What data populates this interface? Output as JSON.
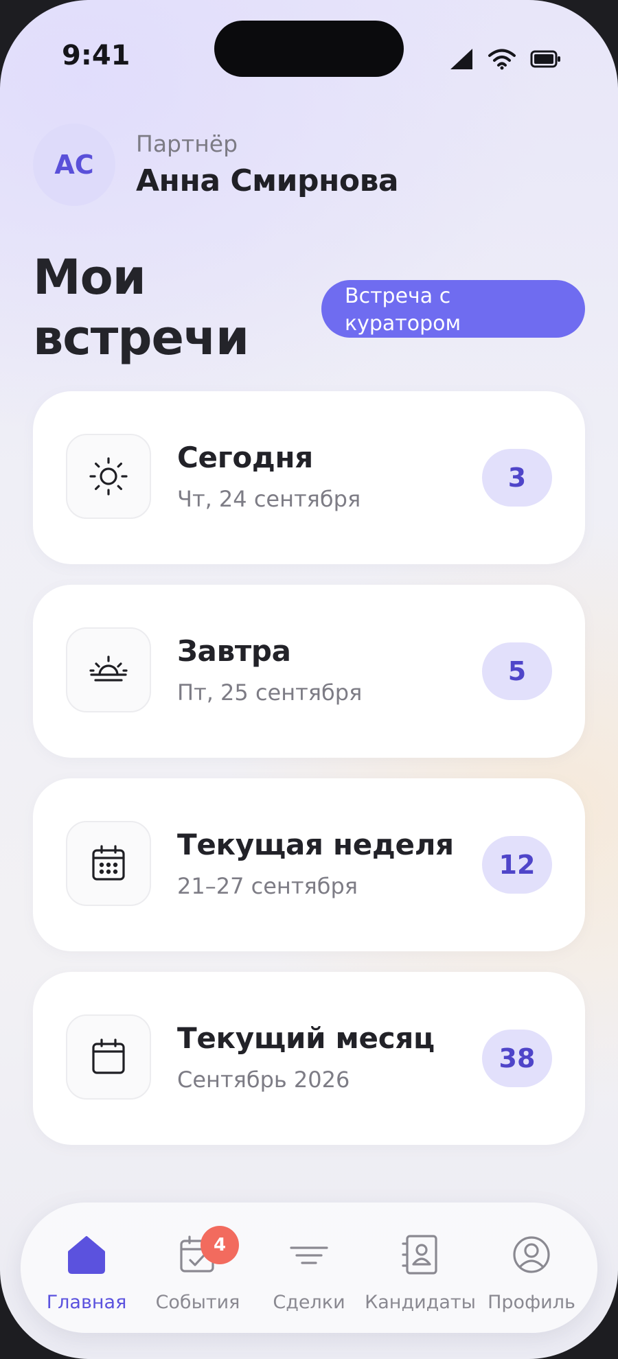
{
  "status": {
    "time": "9:41"
  },
  "header": {
    "avatar_initials": "АС",
    "role": "Партнёр",
    "name": "Анна Смирнова"
  },
  "page": {
    "title": "Мои встречи",
    "curator_button": "Встреча с куратором"
  },
  "cards": [
    {
      "icon": "sun-icon",
      "title": "Сегодня",
      "subtitle": "Чт, 24 сентября",
      "count": "3"
    },
    {
      "icon": "sunrise-icon",
      "title": "Завтра",
      "subtitle": "Пт, 25 сентября",
      "count": "5"
    },
    {
      "icon": "calendar-week-icon",
      "title": "Текущая неделя",
      "subtitle": "21–27 сентября",
      "count": "12"
    },
    {
      "icon": "calendar-icon",
      "title": "Текущий месяц",
      "subtitle": "Сентябрь 2026",
      "count": "38"
    }
  ],
  "tabs": [
    {
      "icon": "home-icon",
      "label": "Главная",
      "active": true
    },
    {
      "icon": "events-icon",
      "label": "События",
      "badge": "4"
    },
    {
      "icon": "filter-icon",
      "label": "Сделки"
    },
    {
      "icon": "contacts-icon",
      "label": "Кандидаты"
    },
    {
      "icon": "profile-icon",
      "label": "Профиль"
    }
  ],
  "colors": {
    "accent": "#6f6cf0",
    "accent_text": "#5b52de",
    "badge": "#f26b5e",
    "count_bg": "#e2e0fb"
  }
}
